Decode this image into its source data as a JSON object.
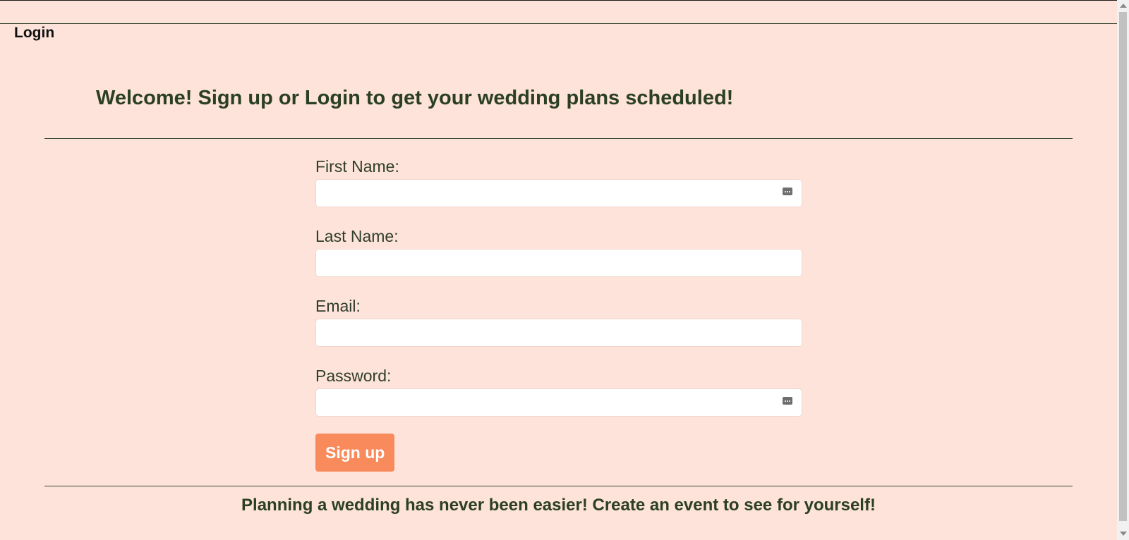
{
  "nav": {
    "login_label": "Login"
  },
  "main": {
    "welcome_heading": "Welcome! Sign up or Login to get your wedding plans scheduled!",
    "tagline": "Planning a wedding has never been easier! Create an event to see for yourself!"
  },
  "form": {
    "first_name": {
      "label": "First Name:",
      "value": "",
      "placeholder": ""
    },
    "last_name": {
      "label": "Last Name:",
      "value": "",
      "placeholder": ""
    },
    "email": {
      "label": "Email:",
      "value": "",
      "placeholder": ""
    },
    "password": {
      "label": "Password:",
      "value": "",
      "placeholder": ""
    },
    "submit_label": "Sign up"
  },
  "colors": {
    "background": "#fde3d9",
    "heading_text": "#2b3f24",
    "button_bg": "#f98a5c",
    "button_text": "#ffffff"
  },
  "icons": {
    "autofill": "password-manager-icon"
  }
}
